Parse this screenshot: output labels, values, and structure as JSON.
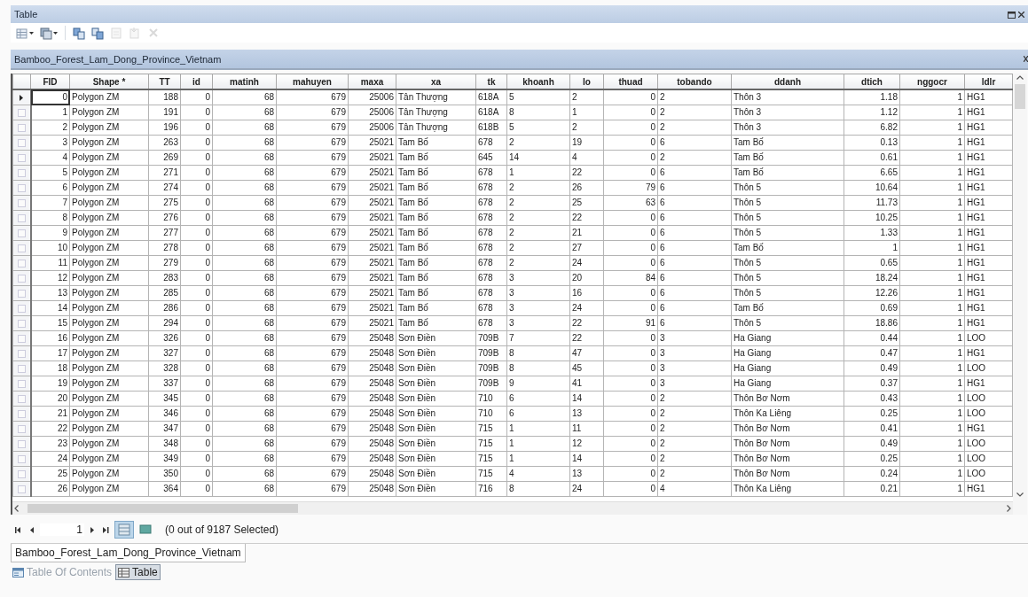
{
  "window": {
    "title": "Table"
  },
  "toolbar": [
    {
      "kind": "grid",
      "menu": true,
      "disabled": false
    },
    {
      "kind": "stack",
      "menu": true,
      "disabled": false
    },
    {
      "kind": "select",
      "menu": false,
      "disabled": false
    },
    {
      "kind": "swap",
      "menu": false,
      "disabled": false
    },
    {
      "kind": "clear",
      "menu": false,
      "disabled": true
    },
    {
      "kind": "zoom",
      "menu": false,
      "disabled": true
    },
    {
      "kind": "delete",
      "menu": false,
      "disabled": true
    }
  ],
  "table_name": "Bamboo_Forest_Lam_Dong_Province_Vietnam",
  "table": {
    "columns": [
      {
        "label": "FID",
        "kind": "number"
      },
      {
        "label": "Shape *",
        "kind": "text"
      },
      {
        "label": "TT",
        "kind": "number"
      },
      {
        "label": "id",
        "kind": "number"
      },
      {
        "label": "matinh",
        "kind": "number"
      },
      {
        "label": "mahuyen",
        "kind": "number"
      },
      {
        "label": "maxa",
        "kind": "number"
      },
      {
        "label": "xa",
        "kind": "text"
      },
      {
        "label": "tk",
        "kind": "text"
      },
      {
        "label": "khoanh",
        "kind": "text"
      },
      {
        "label": "lo",
        "kind": "text"
      },
      {
        "label": "thuad",
        "kind": "number"
      },
      {
        "label": "tobando",
        "kind": "text"
      },
      {
        "label": "ddanh",
        "kind": "text"
      },
      {
        "label": "dtich",
        "kind": "number"
      },
      {
        "label": "nggocr",
        "kind": "number"
      },
      {
        "label": "ldlr",
        "kind": "text"
      }
    ],
    "rows": [
      {
        "current": true,
        "cells": [
          "0",
          "Polygon ZM",
          "188",
          "0",
          "68",
          "679",
          "25006",
          "Tân Thượng",
          "618A",
          "5",
          "2",
          "0",
          "2",
          "Thôn 3",
          "1.18",
          "1",
          "HG1"
        ]
      },
      {
        "current": false,
        "cells": [
          "1",
          "Polygon ZM",
          "191",
          "0",
          "68",
          "679",
          "25006",
          "Tân Thượng",
          "618A",
          "8",
          "1",
          "0",
          "2",
          "Thôn 3",
          "1.12",
          "1",
          "HG1"
        ]
      },
      {
        "current": false,
        "cells": [
          "2",
          "Polygon ZM",
          "196",
          "0",
          "68",
          "679",
          "25006",
          "Tân Thượng",
          "618B",
          "5",
          "2",
          "0",
          "2",
          "Thôn 3",
          "6.82",
          "1",
          "HG1"
        ]
      },
      {
        "current": false,
        "cells": [
          "3",
          "Polygon ZM",
          "263",
          "0",
          "68",
          "679",
          "25021",
          "Tam Bố",
          "678",
          "2",
          "19",
          "0",
          "6",
          "Tam Bố",
          "0.13",
          "1",
          "HG1"
        ]
      },
      {
        "current": false,
        "cells": [
          "4",
          "Polygon ZM",
          "269",
          "0",
          "68",
          "679",
          "25021",
          "Tam Bố",
          "645",
          "14",
          "4",
          "0",
          "2",
          "Tam Bố",
          "0.61",
          "1",
          "HG1"
        ]
      },
      {
        "current": false,
        "cells": [
          "5",
          "Polygon ZM",
          "271",
          "0",
          "68",
          "679",
          "25021",
          "Tam Bố",
          "678",
          "1",
          "22",
          "0",
          "6",
          "Tam Bố",
          "6.65",
          "1",
          "HG1"
        ]
      },
      {
        "current": false,
        "cells": [
          "6",
          "Polygon ZM",
          "274",
          "0",
          "68",
          "679",
          "25021",
          "Tam Bố",
          "678",
          "2",
          "26",
          "79",
          "6",
          "Thôn 5",
          "10.64",
          "1",
          "HG1"
        ]
      },
      {
        "current": false,
        "cells": [
          "7",
          "Polygon ZM",
          "275",
          "0",
          "68",
          "679",
          "25021",
          "Tam Bố",
          "678",
          "2",
          "25",
          "63",
          "6",
          "Thôn 5",
          "11.73",
          "1",
          "HG1"
        ]
      },
      {
        "current": false,
        "cells": [
          "8",
          "Polygon ZM",
          "276",
          "0",
          "68",
          "679",
          "25021",
          "Tam Bố",
          "678",
          "2",
          "22",
          "0",
          "6",
          "Thôn 5",
          "10.25",
          "1",
          "HG1"
        ]
      },
      {
        "current": false,
        "cells": [
          "9",
          "Polygon ZM",
          "277",
          "0",
          "68",
          "679",
          "25021",
          "Tam Bố",
          "678",
          "2",
          "21",
          "0",
          "6",
          "Thôn 5",
          "1.33",
          "1",
          "HG1"
        ]
      },
      {
        "current": false,
        "cells": [
          "10",
          "Polygon ZM",
          "278",
          "0",
          "68",
          "679",
          "25021",
          "Tam Bố",
          "678",
          "2",
          "27",
          "0",
          "6",
          "Tam Bố",
          "1",
          "1",
          "HG1"
        ]
      },
      {
        "current": false,
        "cells": [
          "11",
          "Polygon ZM",
          "279",
          "0",
          "68",
          "679",
          "25021",
          "Tam Bố",
          "678",
          "2",
          "24",
          "0",
          "6",
          "Thôn 5",
          "0.65",
          "1",
          "HG1"
        ]
      },
      {
        "current": false,
        "cells": [
          "12",
          "Polygon ZM",
          "283",
          "0",
          "68",
          "679",
          "25021",
          "Tam Bố",
          "678",
          "3",
          "20",
          "84",
          "6",
          "Thôn 5",
          "18.24",
          "1",
          "HG1"
        ]
      },
      {
        "current": false,
        "cells": [
          "13",
          "Polygon ZM",
          "285",
          "0",
          "68",
          "679",
          "25021",
          "Tam Bố",
          "678",
          "3",
          "16",
          "0",
          "6",
          "Thôn 5",
          "12.26",
          "1",
          "HG1"
        ]
      },
      {
        "current": false,
        "cells": [
          "14",
          "Polygon ZM",
          "286",
          "0",
          "68",
          "679",
          "25021",
          "Tam Bố",
          "678",
          "3",
          "24",
          "0",
          "6",
          "Tam Bố",
          "0.69",
          "1",
          "HG1"
        ]
      },
      {
        "current": false,
        "cells": [
          "15",
          "Polygon ZM",
          "294",
          "0",
          "68",
          "679",
          "25021",
          "Tam Bố",
          "678",
          "3",
          "22",
          "91",
          "6",
          "Thôn 5",
          "18.86",
          "1",
          "HG1"
        ]
      },
      {
        "current": false,
        "cells": [
          "16",
          "Polygon ZM",
          "326",
          "0",
          "68",
          "679",
          "25048",
          "Sơn Điền",
          "709B",
          "7",
          "22",
          "0",
          "3",
          "Ha Giang",
          "0.44",
          "1",
          "LOO"
        ]
      },
      {
        "current": false,
        "cells": [
          "17",
          "Polygon ZM",
          "327",
          "0",
          "68",
          "679",
          "25048",
          "Sơn Điền",
          "709B",
          "8",
          "47",
          "0",
          "3",
          "Ha Giang",
          "0.47",
          "1",
          "HG1"
        ]
      },
      {
        "current": false,
        "cells": [
          "18",
          "Polygon ZM",
          "328",
          "0",
          "68",
          "679",
          "25048",
          "Sơn Điền",
          "709B",
          "8",
          "45",
          "0",
          "3",
          "Ha Giang",
          "0.49",
          "1",
          "LOO"
        ]
      },
      {
        "current": false,
        "cells": [
          "19",
          "Polygon ZM",
          "337",
          "0",
          "68",
          "679",
          "25048",
          "Sơn Điền",
          "709B",
          "9",
          "41",
          "0",
          "3",
          "Ha Giang",
          "0.37",
          "1",
          "HG1"
        ]
      },
      {
        "current": false,
        "cells": [
          "20",
          "Polygon ZM",
          "345",
          "0",
          "68",
          "679",
          "25048",
          "Sơn Điền",
          "710",
          "6",
          "14",
          "0",
          "2",
          "Thôn Bơ Nơm",
          "0.43",
          "1",
          "LOO"
        ]
      },
      {
        "current": false,
        "cells": [
          "21",
          "Polygon ZM",
          "346",
          "0",
          "68",
          "679",
          "25048",
          "Sơn Điền",
          "710",
          "6",
          "13",
          "0",
          "2",
          "Thôn Ka Liêng",
          "0.25",
          "1",
          "LOO"
        ]
      },
      {
        "current": false,
        "cells": [
          "22",
          "Polygon ZM",
          "347",
          "0",
          "68",
          "679",
          "25048",
          "Sơn Điền",
          "715",
          "1",
          "11",
          "0",
          "2",
          "Thôn Bơ Nơm",
          "0.41",
          "1",
          "HG1"
        ]
      },
      {
        "current": false,
        "cells": [
          "23",
          "Polygon ZM",
          "348",
          "0",
          "68",
          "679",
          "25048",
          "Sơn Điền",
          "715",
          "1",
          "12",
          "0",
          "2",
          "Thôn Bơ Nơm",
          "0.49",
          "1",
          "LOO"
        ]
      },
      {
        "current": false,
        "cells": [
          "24",
          "Polygon ZM",
          "349",
          "0",
          "68",
          "679",
          "25048",
          "Sơn Điền",
          "715",
          "1",
          "14",
          "0",
          "2",
          "Thôn Bơ Nơm",
          "0.25",
          "1",
          "LOO"
        ]
      },
      {
        "current": false,
        "cells": [
          "25",
          "Polygon ZM",
          "350",
          "0",
          "68",
          "679",
          "25048",
          "Sơn Điền",
          "715",
          "4",
          "13",
          "0",
          "2",
          "Thôn Bơ Nơm",
          "0.24",
          "1",
          "LOO"
        ]
      },
      {
        "current": false,
        "cells": [
          "26",
          "Polygon ZM",
          "364",
          "0",
          "68",
          "679",
          "25048",
          "Sơn Điền",
          "716",
          "8",
          "24",
          "0",
          "4",
          "Thôn Ka Liêng",
          "0.21",
          "1",
          "HG1"
        ]
      }
    ]
  },
  "navigation": {
    "record": "1",
    "views": [
      {
        "kind": "all",
        "selected": true
      },
      {
        "kind": "selected",
        "selected": false
      }
    ],
    "status": "(0 out of 9187 Selected)"
  },
  "table_tabs": [
    {
      "label": "Bamboo_Forest_Lam_Dong_Province_Vietnam",
      "selected": true
    }
  ],
  "dock_tabs": [
    {
      "label": "Table Of Contents",
      "kind": "toc",
      "selected": false
    },
    {
      "label": "Table",
      "kind": "table",
      "selected": true
    }
  ]
}
